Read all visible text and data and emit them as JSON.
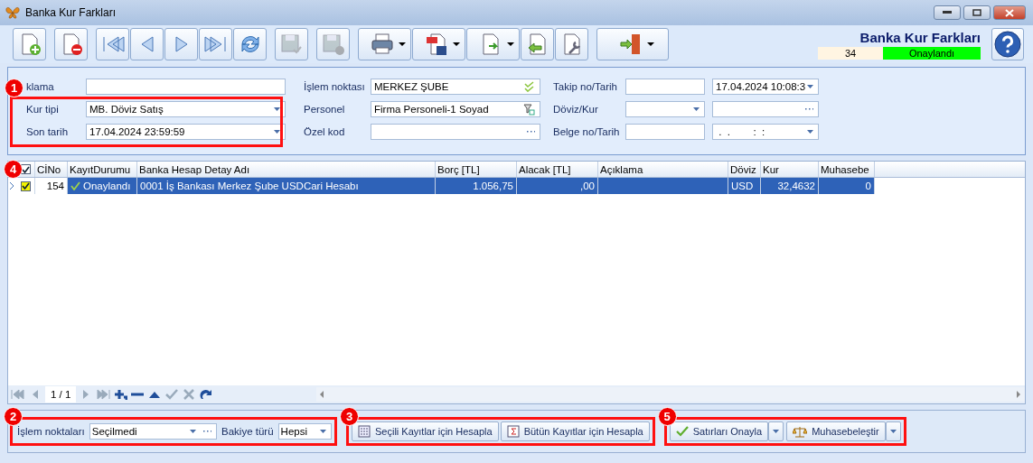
{
  "window": {
    "title": "Banka Kur Farkları"
  },
  "toolbar": {
    "buttons": [
      {
        "disabled": false,
        "has_menu": false
      },
      {
        "disabled": false,
        "has_menu": false
      },
      {
        "disabled": false,
        "has_menu": false
      },
      {
        "disabled": false,
        "has_menu": false
      },
      {
        "disabled": false,
        "has_menu": false
      },
      {
        "disabled": false,
        "has_menu": false
      },
      {
        "disabled": false,
        "has_menu": false
      },
      {
        "disabled": true,
        "has_menu": false
      },
      {
        "disabled": true,
        "has_menu": false
      },
      {
        "disabled": false,
        "has_menu": true
      },
      {
        "disabled": false,
        "has_menu": true
      },
      {
        "disabled": false,
        "has_menu": true
      },
      {
        "disabled": false,
        "has_menu": false
      },
      {
        "disabled": false,
        "has_menu": false
      },
      {
        "disabled": false,
        "has_menu": true
      }
    ],
    "heading": "Banka Kur Farkları",
    "record_no": "34",
    "status": "Onaylandı"
  },
  "form": {
    "callout": "1",
    "columns": [
      [
        {
          "label": "klama",
          "inputs": [
            {
              "kind": "text"
            }
          ]
        },
        {
          "label": "Kur tipi",
          "inputs": [
            {
              "kind": "combo",
              "value": "MB. Döviz Satış"
            }
          ]
        },
        {
          "label": "Son tarih",
          "inputs": [
            {
              "kind": "combo",
              "value": "17.04.2024 23:59:59"
            }
          ]
        }
      ],
      [
        {
          "label": "İşlem noktası",
          "inputs": [
            {
              "kind": "check",
              "value": "MERKEZ ŞUBE"
            }
          ]
        },
        {
          "label": "Personel",
          "inputs": [
            {
              "kind": "lookup",
              "value": "Firma Personeli-1 Soyad"
            }
          ]
        },
        {
          "label": "Özel kod",
          "inputs": [
            {
              "kind": "ellipsis"
            }
          ]
        }
      ],
      [
        {
          "label": "Takip no/Tarih",
          "inputs": [
            {
              "kind": "text"
            },
            {
              "kind": "combo",
              "value": "17.04.2024 10:08:3"
            }
          ]
        },
        {
          "label": "Döviz/Kur",
          "inputs": [
            {
              "kind": "combo"
            },
            {
              "kind": "ellipsis"
            }
          ]
        },
        {
          "label": "Belge no/Tarih",
          "inputs": [
            {
              "kind": "text"
            },
            {
              "kind": "combo",
              "value": " .  .        :  :"
            }
          ]
        }
      ]
    ]
  },
  "grid": {
    "callout": "4",
    "header_checked": true,
    "columns": [
      "CİNo",
      "KayıtDurumu",
      "Banka Hesap Detay Adı",
      "Borç [TL]",
      "Alacak [TL]",
      "Açıklama",
      "Döviz",
      "Kur",
      "Muhasebe"
    ],
    "rows": [
      {
        "selected": true,
        "checked": true,
        "cells": [
          "154",
          "Onaylandı",
          "0001 İş Bankası Merkez Şube USDCari Hesabı",
          "1.056,75",
          ",00",
          "",
          "USD",
          "32,4632",
          "0"
        ]
      }
    ],
    "pager": "1 / 1"
  },
  "filters": {
    "callout": "2",
    "fields": [
      {
        "label": "İşlem noktaları",
        "value": "Seçilmedi",
        "kind": "combo-ellipsis"
      },
      {
        "label": "Bakiye türü",
        "value": "Hepsi",
        "kind": "combo"
      }
    ]
  },
  "calc_buttons": {
    "callout": "3",
    "buttons": [
      "Seçili Kayıtlar için Hesapla",
      "Bütün Kayıtlar için Hesapla"
    ]
  },
  "action_buttons": {
    "callout": "5",
    "buttons": [
      "Satırları Onayla",
      "Muhasebeleştir"
    ]
  }
}
